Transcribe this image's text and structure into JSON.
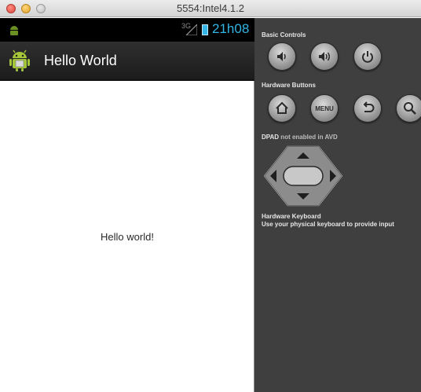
{
  "window": {
    "title": "5554:Intel4.1.2"
  },
  "statusbar": {
    "signal_label": "3G",
    "time": "21h08"
  },
  "actionbar": {
    "title": "Hello World"
  },
  "content": {
    "text": "Hello world!"
  },
  "panel": {
    "basic_controls_label": "Basic Controls",
    "hardware_buttons_label": "Hardware Buttons",
    "menu_label": "MENU",
    "dpad_label_prefix": "DPAD",
    "dpad_label_suffix": " not enabled in AVD",
    "keyboard_label": "Hardware Keyboard",
    "keyboard_hint": "Use your physical keyboard to provide input"
  },
  "colors": {
    "accent": "#33b5e5",
    "panel_bg": "#3f3f3f",
    "android_green": "#a4c639"
  }
}
